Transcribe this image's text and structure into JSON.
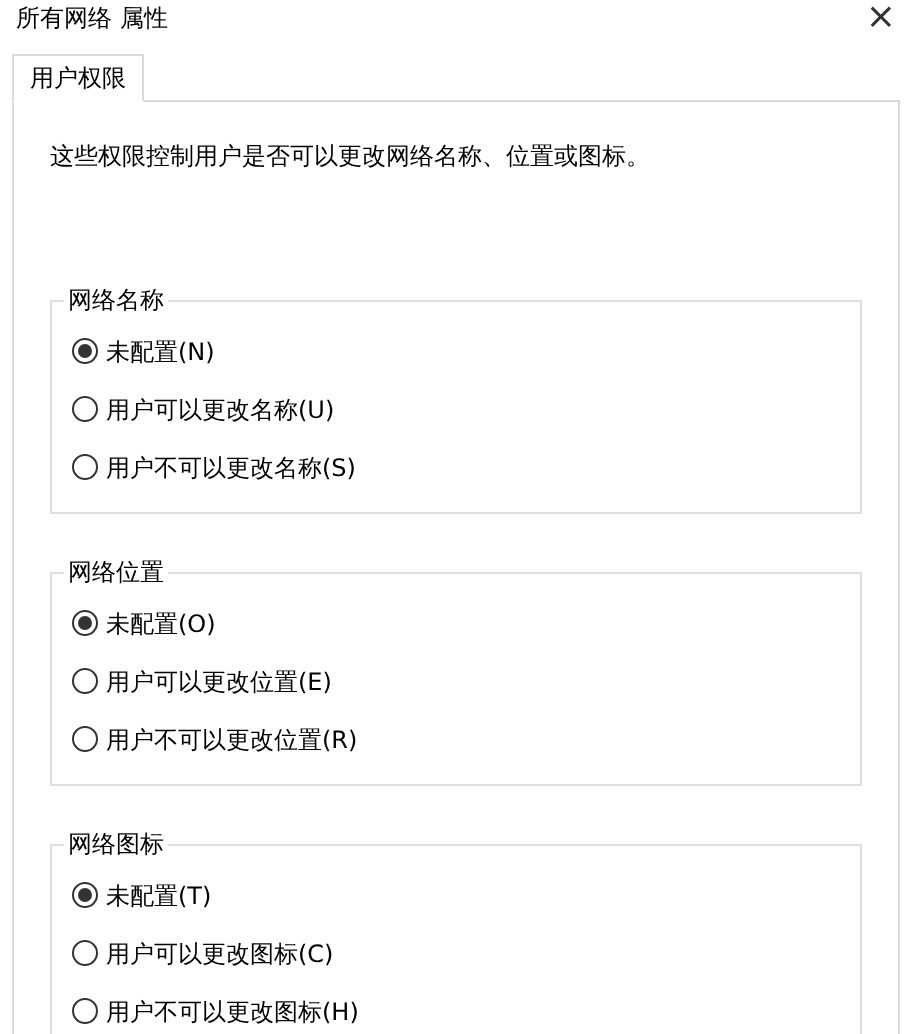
{
  "window": {
    "title": "所有网络 属性",
    "close": "×"
  },
  "tabs": [
    {
      "label": "用户权限",
      "selected": true
    }
  ],
  "description": "这些权限控制用户是否可以更改网络名称、位置或图标。",
  "groups": [
    {
      "title": "网络名称",
      "options": [
        {
          "label": "未配置(N)",
          "selected": true
        },
        {
          "label": "用户可以更改名称(U)",
          "selected": false
        },
        {
          "label": "用户不可以更改名称(S)",
          "selected": false
        }
      ]
    },
    {
      "title": "网络位置",
      "options": [
        {
          "label": "未配置(O)",
          "selected": true
        },
        {
          "label": "用户可以更改位置(E)",
          "selected": false
        },
        {
          "label": "用户不可以更改位置(R)",
          "selected": false
        }
      ]
    },
    {
      "title": "网络图标",
      "options": [
        {
          "label": "未配置(T)",
          "selected": true
        },
        {
          "label": "用户可以更改图标(C)",
          "selected": false
        },
        {
          "label": "用户不可以更改图标(H)",
          "selected": false
        }
      ]
    }
  ]
}
